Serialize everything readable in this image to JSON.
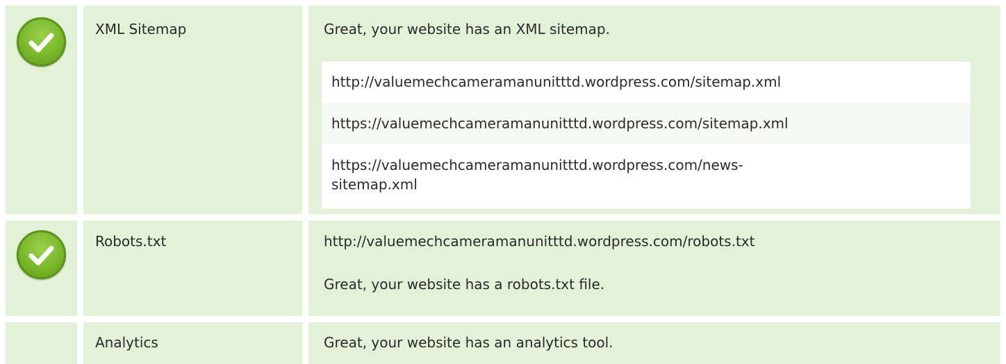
{
  "rows": [
    {
      "label": "XML Sitemap",
      "message": "Great, your website has an XML sitemap.",
      "sitemaps": [
        "http://valuemechcameramanunitttd.wordpress.com/sitemap.xml",
        "https://valuemechcameramanunitttd.wordpress.com/sitemap.xml",
        "https://valuemechcameramanunitttd.wordpress.com/news-sitemap.xml"
      ],
      "status_icon": "check-icon"
    },
    {
      "label": "Robots.txt",
      "url": "http://valuemechcameramanunitttd.wordpress.com/robots.txt",
      "message": "Great, your website has a robots.txt file.",
      "status_icon": "check-icon"
    },
    {
      "label": "Analytics",
      "message": "Great, your website has an analytics tool."
    }
  ],
  "colors": {
    "row_background": "#e2f1d8",
    "check_green": "#7bb82b"
  }
}
